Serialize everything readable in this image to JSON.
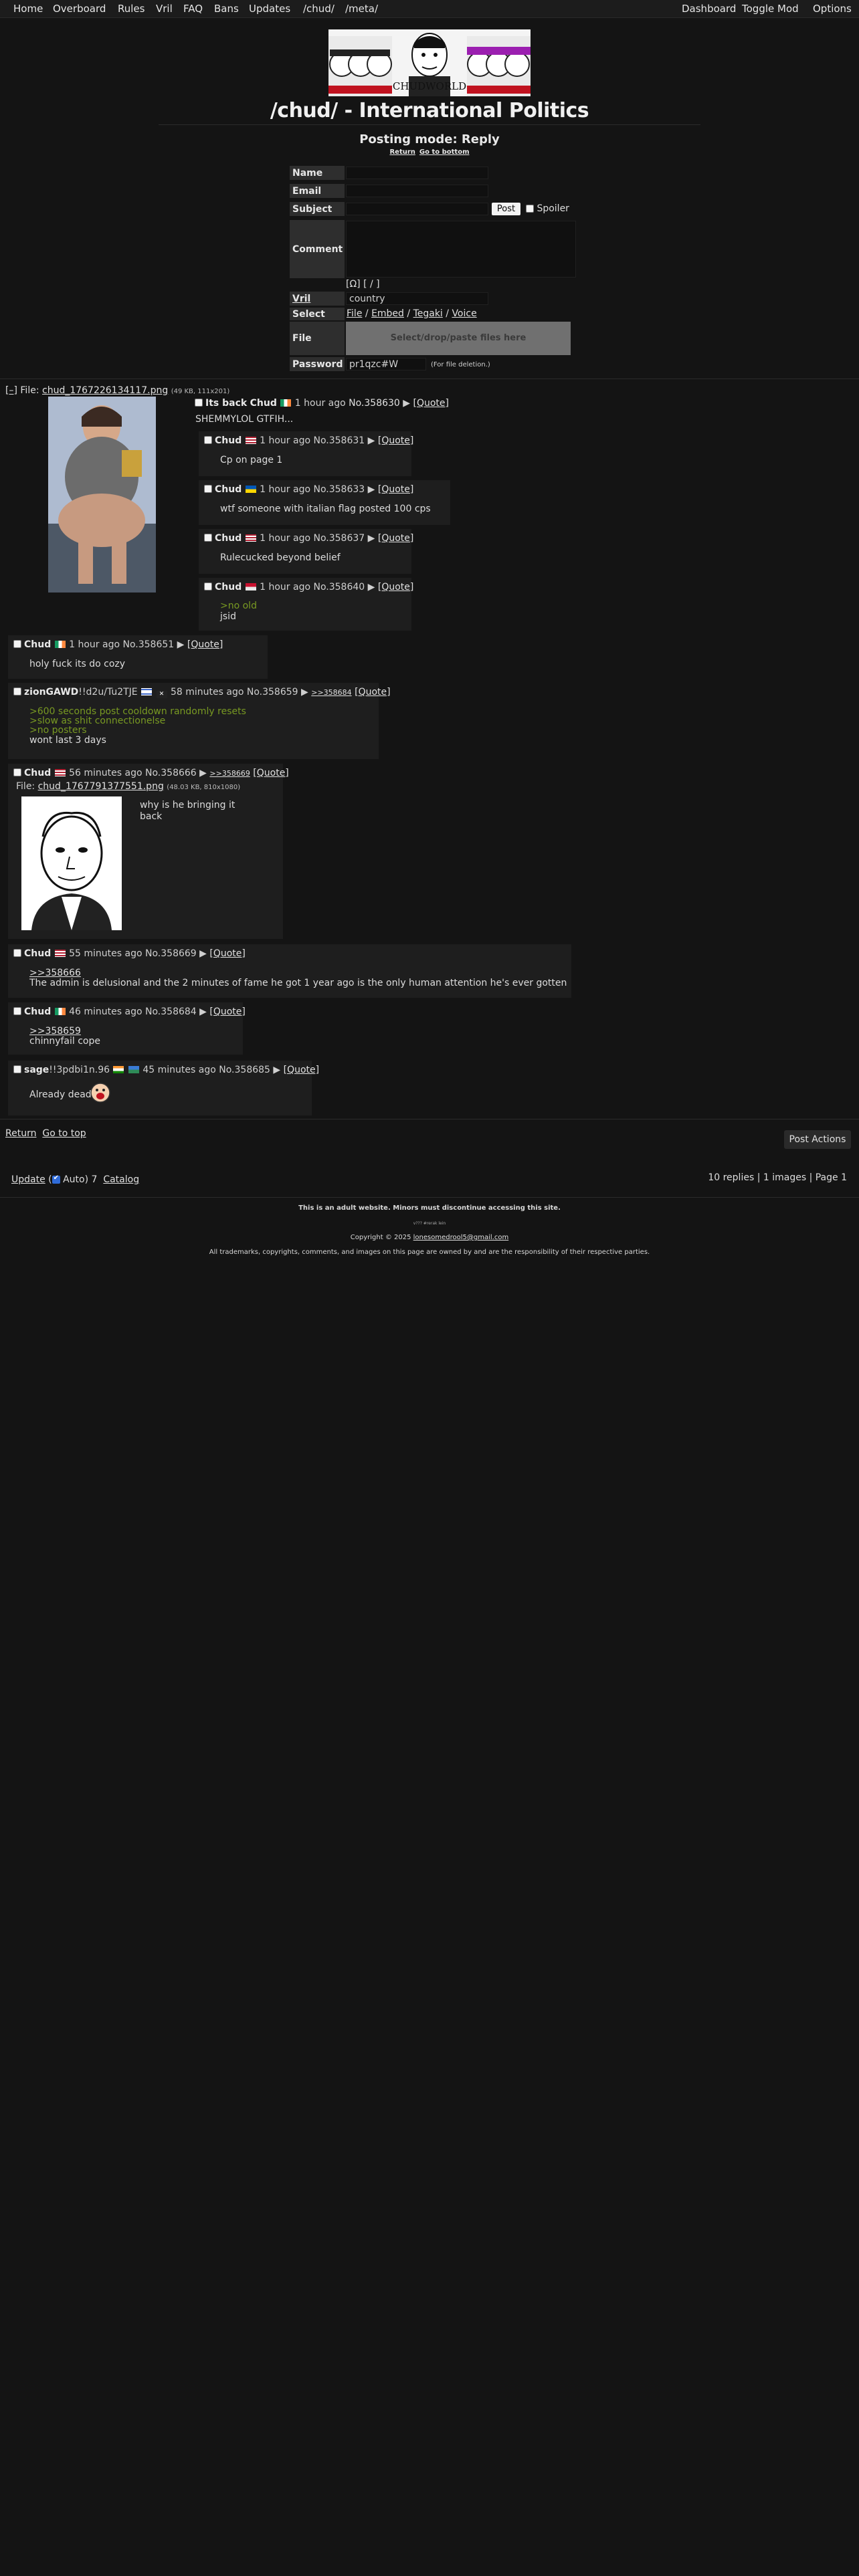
{
  "nav": {
    "left": [
      "Home",
      "Overboard",
      "Rules",
      "Vril",
      "FAQ",
      "Bans",
      "Updates",
      "/chud/",
      "/meta/"
    ],
    "right": [
      "Dashboard",
      "Toggle Mod",
      "Options"
    ]
  },
  "banner": {
    "text": "CHUDWORLD"
  },
  "board": {
    "title": "/chud/ - International Politics",
    "posting_mode": "Posting mode: Reply",
    "return_link": "Return",
    "bottom_link": "Go to bottom"
  },
  "form": {
    "labels": {
      "name": "Name",
      "email": "Email",
      "subject": "Subject",
      "comment": "Comment",
      "vril": "Vril",
      "select": "Select",
      "file": "File",
      "password": "Password"
    },
    "post_button": "Post",
    "spoiler_label": "Spoiler",
    "formatting_tools": "[Ω] [ / ]",
    "vril_value": "country",
    "select_options": {
      "file": "File",
      "embed": "Embed",
      "tegaki": "Tegaki",
      "voice": "Voice"
    },
    "dropzone": "Select/drop/paste files here",
    "password_value": "pr1qzc#W",
    "password_note": "(For file deletion.)"
  },
  "op": {
    "toggle": "[–]",
    "file_prefix": "File:",
    "file_name": "chud_1767226134117.png",
    "file_meta": "(49 KB, 111x201)",
    "subject": "Its back",
    "name": "Chud",
    "time": "1 hour ago",
    "no": "No.358630",
    "arrow": "▶",
    "quote": "[Quote]",
    "body": "SHEMMYLOL GTFIH..."
  },
  "replies": [
    {
      "name": "Chud",
      "flag": "us",
      "time": "1 hour ago",
      "no": "No.358631",
      "quote": "[Quote]",
      "body": "Cp on page 1"
    },
    {
      "name": "Chud",
      "flag": "ua",
      "time": "1 hour ago",
      "no": "No.358633",
      "quote": "[Quote]",
      "body": "wtf someone with italian flag posted 100 cps"
    },
    {
      "name": "Chud",
      "flag": "us",
      "time": "1 hour ago",
      "no": "No.358637",
      "quote": "[Quote]",
      "body": "Rulecucked beyond belief"
    },
    {
      "name": "Chud",
      "flag": "other",
      "time": "1 hour ago",
      "no": "No.358640",
      "quote": "[Quote]",
      "green": ">no old",
      "body": "jsid"
    },
    {
      "name": "Chud",
      "flag": "ie",
      "time": "1 hour ago",
      "no": "No.358651",
      "quote": "[Quote]",
      "body": "holy fuck its do cozy"
    },
    {
      "name": "zionGAWD",
      "trip": "!!d2u/Tu2TJE",
      "flag": "il",
      "time": "58 minutes ago",
      "no": "No.358659",
      "backlink": ">>358684",
      "quote": "[Quote]",
      "green_lines": [
        ">600 seconds post cooldown randomly resets",
        ">slow as shit connectionelse",
        ">no posters"
      ],
      "body": "wont last 3 days"
    },
    {
      "name": "Chud",
      "flag": "us",
      "time": "56 minutes ago",
      "no": "No.358666",
      "backlink": ">>358669",
      "quote": "[Quote]",
      "file_prefix": "File:",
      "file_name": "chud_1767791377551.png",
      "file_meta": "(48.03 KB, 810x1080)",
      "body": "why is he bringing it back"
    },
    {
      "name": "Chud",
      "flag": "us",
      "time": "55 minutes ago",
      "no": "No.358669",
      "quote": "[Quote]",
      "reply_to": ">>358666",
      "body": "The admin is delusional and the 2 minutes of fame he got 1 year ago is the only human attention he's ever gotten"
    },
    {
      "name": "Chud",
      "flag": "ie",
      "time": "46 minutes ago",
      "no": "No.358684",
      "quote": "[Quote]",
      "reply_to": ">>358659",
      "body": "chinnyfail cope"
    },
    {
      "name": "sage",
      "trip": "!!3pdbi1n.96",
      "flag": "in",
      "time": "45 minutes ago",
      "no": "No.358685",
      "quote": "[Quote]",
      "body": "Already dead"
    }
  ],
  "bottom": {
    "return": "Return",
    "top": "Go to top",
    "post_actions": "Post Actions",
    "update": "Update",
    "auto": "Auto)",
    "countdown": "7",
    "open_paren": "(",
    "catalog": "Catalog",
    "stats": "10 replies | 1 images | Page 1"
  },
  "footer": {
    "adult": "This is an adult website. Minors must discontinue accessing this site.",
    "version": "v??? #rerak lein",
    "copyright_prefix": "Copyright © 2025",
    "email": "lonesomedrool5@gmail.com",
    "disclaimer": "All trademarks, copyrights, comments, and images on this page are owned by and are the responsibility of their respective parties."
  }
}
